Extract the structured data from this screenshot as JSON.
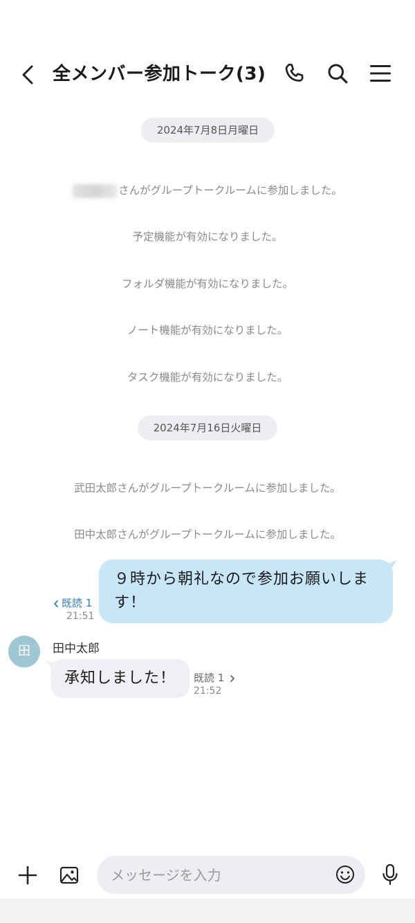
{
  "header": {
    "title": "全メンバー参加トーク(3)",
    "icons": {
      "back": "chevron-left-icon",
      "call": "phone-icon",
      "search": "search-icon",
      "menu": "hamburger-menu-icon"
    }
  },
  "dates": [
    "2024年7月8日月曜日",
    "2024年7月16日火曜日"
  ],
  "system_messages": {
    "joined_hidden_suffix": "さんがグループトークルームに参加しました。",
    "schedule_enabled": "予定機能が有効になりました。",
    "folder_enabled": "フォルダ機能が有効になりました。",
    "note_enabled": "ノート機能が有効になりました。",
    "task_enabled": "タスク機能が有効になりました。",
    "takeda_joined": "武田太郎さんがグループトークルームに参加しました。",
    "tanaka_joined": "田中太郎さんがグループトークルームに参加しました。"
  },
  "outgoing": {
    "text": "９時から朝礼なので参加お願いします！",
    "read_label": "既読 1",
    "time": "21:51"
  },
  "incoming": {
    "avatar_initial": "田",
    "sender": "田中太郎",
    "text": "承知しました！",
    "read_label": "既読 1",
    "time": "21:52"
  },
  "composer": {
    "placeholder": "メッセージを入力",
    "icons": {
      "plus": "plus-icon",
      "image": "image-icon",
      "emoji": "emoji-icon",
      "mic": "microphone-icon"
    }
  },
  "colors": {
    "outgoing_bubble": "#c7e6f8",
    "incoming_bubble": "#eef0f4",
    "read_link": "#2f7fcf"
  }
}
